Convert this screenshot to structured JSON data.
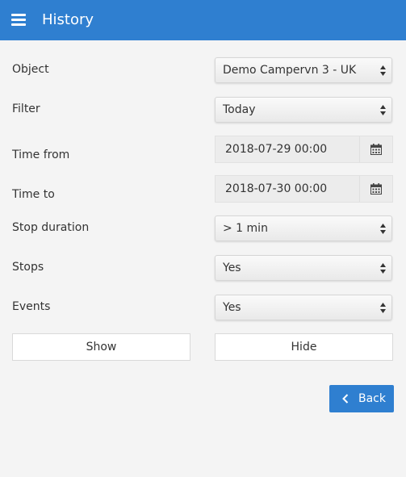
{
  "header": {
    "title": "History",
    "menu_icon": "hamburger-menu-icon",
    "color": "#2f7fd0"
  },
  "form": {
    "object": {
      "label": "Object",
      "value": "Demo Campervn 3 - UK"
    },
    "filter": {
      "label": "Filter",
      "value": "Today"
    },
    "time_from": {
      "label": "Time from",
      "value": "2018-07-29 00:00",
      "icon": "calendar-icon"
    },
    "time_to": {
      "label": "Time to",
      "value": "2018-07-30 00:00",
      "icon": "calendar-icon"
    },
    "stop_duration": {
      "label": "Stop duration",
      "value": "> 1 min"
    },
    "stops": {
      "label": "Stops",
      "value": "Yes"
    },
    "events": {
      "label": "Events",
      "value": "Yes"
    }
  },
  "actions": {
    "show_label": "Show",
    "hide_label": "Hide",
    "back_label": "Back",
    "back_icon": "chevron-left-icon"
  }
}
